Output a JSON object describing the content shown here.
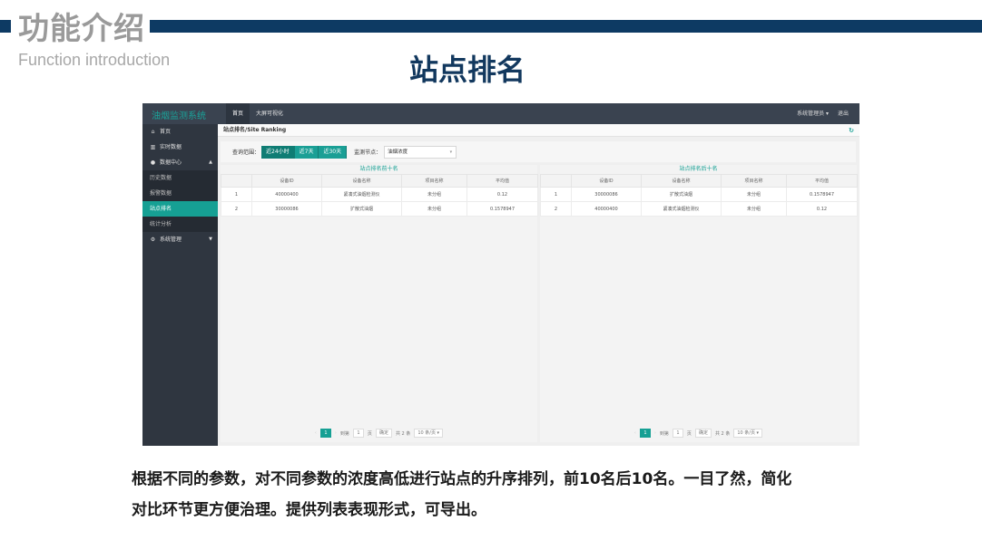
{
  "slide": {
    "header_title": "功能介绍",
    "header_subtitle": "Function introduction",
    "title": "站点排名",
    "description_lines": [
      "根据不同的参数，对不同参数的浓度高低进行站点的升序排列，前10名后10名。一目了然，简化",
      "对比环节更方便治理。提供列表表现形式，可导出。"
    ],
    "colors": {
      "header_bar": "#0d3a63",
      "title": "#12385e",
      "accent": "#16a094"
    }
  },
  "app": {
    "logo": "油烟监测系统",
    "top_nav": [
      "首页",
      "大屏可视化"
    ],
    "top_right": {
      "user": "系统管理员 ▾",
      "logout": "退出"
    },
    "sidebar": {
      "home": "首页",
      "realtime": "实时数据",
      "data_center": "数据中心",
      "sub_items": [
        "历史数据",
        "报警数据",
        "站点排名",
        "统计分析"
      ],
      "system": "系统管理"
    },
    "breadcrumb": "站点排名/Site Ranking",
    "filter": {
      "range_label": "查询范围：",
      "range_buttons": [
        "近24小时",
        "近7天",
        "近30天"
      ],
      "monitor_label": "监测节点：",
      "monitor_value": "油烟浓度"
    },
    "columns": [
      "",
      "设备ID",
      "设备名称",
      "项目名称",
      "平均值"
    ],
    "panels": [
      {
        "title": "站点排名前十名",
        "rows": [
          [
            "1",
            "40000400",
            "紧凑式油烟检测仪",
            "未分组",
            "0.12"
          ],
          [
            "2",
            "30000086",
            "扩散式油烟",
            "未分组",
            "0.1578947"
          ]
        ]
      },
      {
        "title": "站点排名后十名",
        "rows": [
          [
            "1",
            "30000086",
            "扩散式油烟",
            "未分组",
            "0.1578947"
          ],
          [
            "2",
            "40000400",
            "紧凑式油烟检测仪",
            "未分组",
            "0.12"
          ]
        ]
      }
    ],
    "pager": {
      "prev": "‹",
      "current": "1",
      "next": "›",
      "goto_label": "到第",
      "goto_value": "1",
      "page_unit": "页",
      "confirm": "确定",
      "total": "共 2 条",
      "page_size": "10 条/页 ▾"
    }
  }
}
